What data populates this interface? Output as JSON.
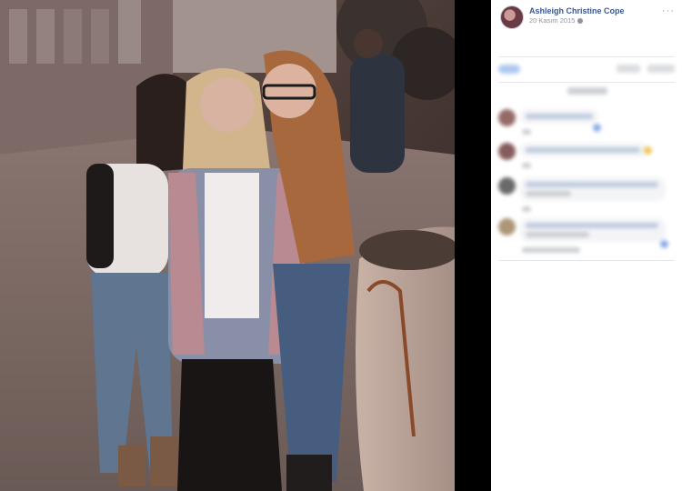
{
  "post": {
    "author_name": "Ashleigh Christine Cope",
    "date": "20 Kasım 2015",
    "privacy_icon": "globe-icon",
    "more_icon": "more-options-icon",
    "more_label": "···"
  },
  "photo": {
    "description_icon": "group-photo"
  },
  "actions": {
    "reactions_icon": "reactions-icon",
    "blurred": true
  },
  "comments": {
    "count_visible": 4,
    "blurred": true
  },
  "colors": {
    "link": "#385898",
    "meta": "#90949c",
    "bubble": "#f2f3f5",
    "background": "#000000"
  }
}
